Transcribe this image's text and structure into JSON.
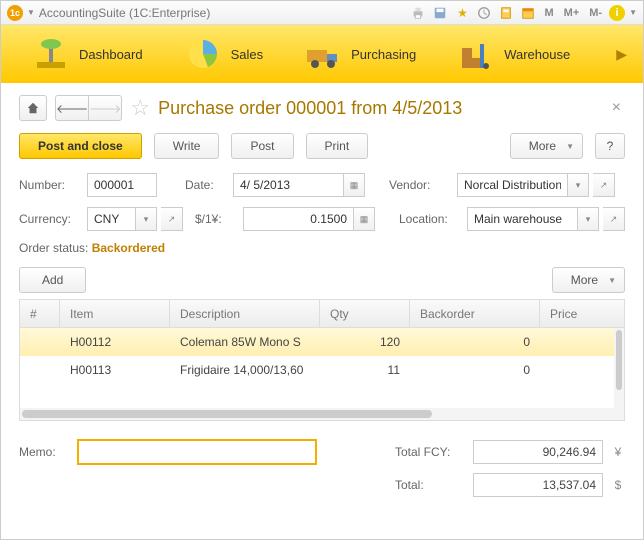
{
  "titlebar": {
    "app": "AccountingSuite (1C:Enterprise)",
    "m1": "M",
    "m2": "M+",
    "m3": "M-"
  },
  "nav": {
    "items": [
      {
        "label": "Dashboard"
      },
      {
        "label": "Sales"
      },
      {
        "label": "Purchasing"
      },
      {
        "label": "Warehouse"
      }
    ]
  },
  "page": {
    "title": "Purchase order 000001 from 4/5/2013",
    "post_close": "Post and close",
    "write": "Write",
    "post": "Post",
    "print": "Print",
    "more": "More",
    "q": "?"
  },
  "form": {
    "number_lbl": "Number:",
    "number": "000001",
    "date_lbl": "Date:",
    "date": "4/ 5/2013",
    "vendor_lbl": "Vendor:",
    "vendor": "Norcal Distribution",
    "currency_lbl": "Currency:",
    "currency": "CNY",
    "rate_lbl": "$/1¥:",
    "rate": "0.1500",
    "location_lbl": "Location:",
    "location": "Main warehouse",
    "status_lbl": "Order status:",
    "status": "Backordered",
    "add": "Add",
    "more": "More"
  },
  "table": {
    "cols": {
      "num": "#",
      "item": "Item",
      "desc": "Description",
      "qty": "Qty",
      "bo": "Backorder",
      "price": "Price"
    },
    "rows": [
      {
        "item": "H00112",
        "desc": "Coleman 85W Mono S",
        "qty": "120",
        "bo": "0"
      },
      {
        "item": "H00113",
        "desc": "Frigidaire 14,000/13,60",
        "qty": "11",
        "bo": "0"
      }
    ]
  },
  "totals": {
    "memo_lbl": "Memo:",
    "memo": "",
    "fcy_lbl": "Total FCY:",
    "fcy": "90,246.94",
    "fcy_cur": "¥",
    "total_lbl": "Total:",
    "total": "13,537.04",
    "total_cur": "$"
  }
}
